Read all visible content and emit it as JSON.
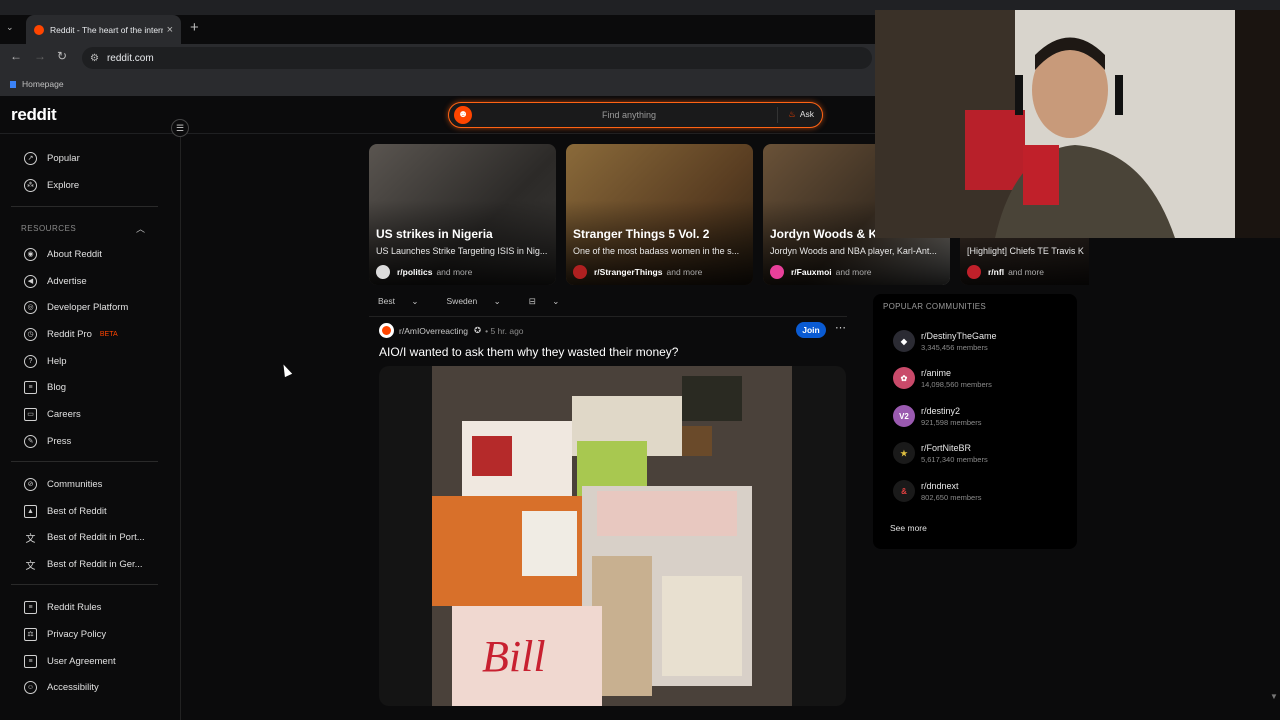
{
  "browser": {
    "tab_title": "Reddit - The heart of the internet",
    "url": "reddit.com",
    "bookmark": "Homepage"
  },
  "header": {
    "logo": "reddit",
    "search_placeholder": "Find anything",
    "ask_label": "Ask"
  },
  "sidebar": {
    "top_items": [
      {
        "label": "Popular",
        "icon": "popular-icon"
      },
      {
        "label": "Explore",
        "icon": "explore-icon"
      }
    ],
    "resources_heading": "RESOURCES",
    "resources": [
      {
        "label": "About Reddit"
      },
      {
        "label": "Advertise"
      },
      {
        "label": "Developer Platform"
      },
      {
        "label": "Reddit Pro",
        "badge": "BETA"
      },
      {
        "label": "Help"
      },
      {
        "label": "Blog"
      },
      {
        "label": "Careers"
      },
      {
        "label": "Press"
      }
    ],
    "community_items": [
      {
        "label": "Communities"
      },
      {
        "label": "Best of Reddit"
      },
      {
        "label": "Best of Reddit in Port..."
      },
      {
        "label": "Best of Reddit in Ger..."
      }
    ],
    "legal_items": [
      {
        "label": "Reddit Rules"
      },
      {
        "label": "Privacy Policy"
      },
      {
        "label": "User Agreement"
      },
      {
        "label": "Accessibility"
      }
    ]
  },
  "carousel": [
    {
      "title": "US strikes in Nigeria",
      "subtitle": "US Launches Strike Targeting ISIS in Nig...",
      "community": "r/politics",
      "more": "and more"
    },
    {
      "title": "Stranger Things 5 Vol. 2",
      "subtitle": "One of the most badass women in the s...",
      "community": "r/StrangerThings",
      "more": "and more"
    },
    {
      "title": "Jordyn Woods & K...",
      "subtitle": "Jordyn Woods and NBA player, Karl-Ant...",
      "community": "r/Fauxmoi",
      "more": "and more"
    },
    {
      "title": "",
      "subtitle": "[Highlight] Chiefs TE Travis K",
      "community": "r/nfl",
      "more": "and more"
    }
  ],
  "sort": {
    "order": "Best",
    "region": "Sweden"
  },
  "post": {
    "subreddit": "r/AmIOverreacting",
    "time": "5 hr. ago",
    "join_label": "Join",
    "title": "AIO/I wanted to ask them why they wasted their money?"
  },
  "popular": {
    "heading": "POPULAR COMMUNITIES",
    "communities": [
      {
        "name": "r/DestinyTheGame",
        "members": "3,345,456 members"
      },
      {
        "name": "r/anime",
        "members": "14,098,560 members"
      },
      {
        "name": "r/destiny2",
        "members": "921,598 members"
      },
      {
        "name": "r/FortNiteBR",
        "members": "5,617,340 members"
      },
      {
        "name": "r/dndnext",
        "members": "802,650 members"
      }
    ],
    "see_more": "See more"
  }
}
